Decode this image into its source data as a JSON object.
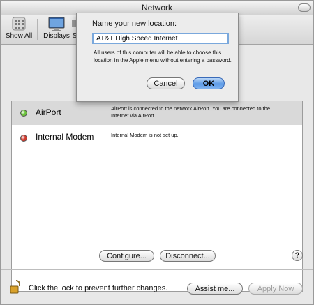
{
  "window": {
    "title": "Network"
  },
  "toolbar": {
    "items": [
      {
        "label": "Show All",
        "icon": "show-all-icon"
      },
      {
        "label": "Displays",
        "icon": "displays-icon"
      },
      {
        "label": "S",
        "icon": "sound-icon"
      }
    ]
  },
  "services": [
    {
      "name": "AirPort",
      "status_color": "#6cc23c",
      "description": "AirPort is connected to the network AirPort. You are connected to the Internet via AirPort.",
      "selected": true
    },
    {
      "name": "Internal Modem",
      "status_color": "#d23a2e",
      "description": "Internal Modem is not set up.",
      "selected": false
    }
  ],
  "actions": {
    "configure": "Configure...",
    "disconnect": "Disconnect...",
    "help": "?",
    "assist": "Assist me...",
    "apply": "Apply Now"
  },
  "lock": {
    "text": "Click the lock to prevent further changes.",
    "icon": "lock-icon"
  },
  "sheet": {
    "label": "Name your new location:",
    "input_value": "AT&T High Speed Internet",
    "help_text": "All users of this computer will be able to choose this location in the Apple menu without entering a password.",
    "cancel": "Cancel",
    "ok": "OK"
  },
  "colors": {
    "accent": "#5d9be7",
    "focus_ring": "#7aa8dc"
  }
}
